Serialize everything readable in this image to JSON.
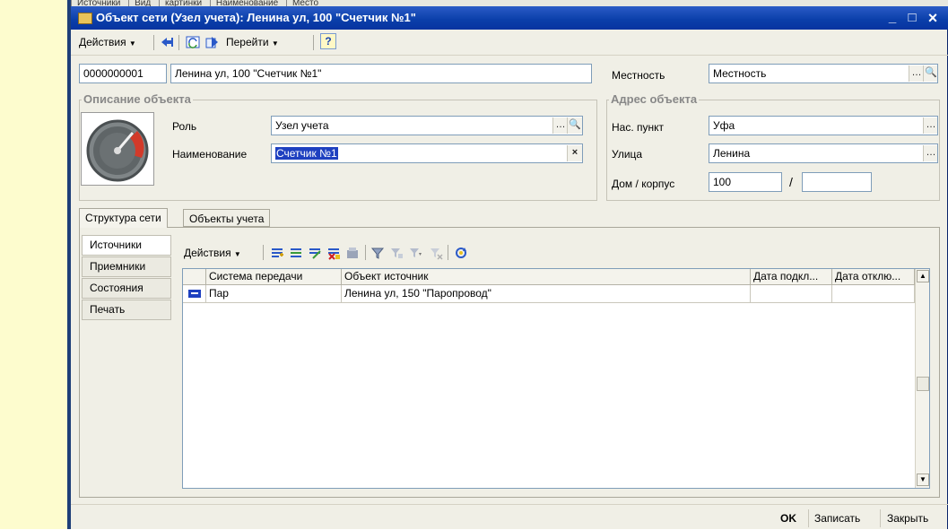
{
  "window": {
    "title": "Объект сети (Узел учета): Ленина ул, 100 \"Счетчик №1\"",
    "min": "_",
    "max": "□",
    "close": "×"
  },
  "top_remnant": {
    "items": [
      "Источники",
      "Вид",
      "картинки",
      "Наименование",
      "Место"
    ]
  },
  "toolbar": {
    "actions_label": "Действия",
    "goto_label": "Перейти",
    "help_label": "?"
  },
  "header": {
    "code": "0000000001",
    "name": "Ленина ул, 100 \"Счетчик №1\"",
    "locality_label": "Местность",
    "locality_value": "Местность"
  },
  "description": {
    "group_title": "Описание объекта",
    "role_label": "Роль",
    "role_value": "Узел учета",
    "name_label": "Наименование",
    "name_value": "Счетчик №1"
  },
  "address": {
    "group_title": "Адрес объекта",
    "city_label": "Нас. пункт",
    "city_value": "Уфа",
    "street_label": "Улица",
    "street_value": "Ленина",
    "house_label": "Дом / корпус",
    "house_value": "100",
    "slash": "/",
    "corpus_value": ""
  },
  "tabs": [
    "Структура сети",
    "Объекты учета"
  ],
  "side_tabs": [
    "Источники",
    "Приемники",
    "Состояния",
    "Печать"
  ],
  "grid_toolbar": {
    "actions_label": "Действия"
  },
  "grid": {
    "columns": [
      "Система передачи",
      "Объект источник",
      "Дата подкл...",
      "Дата отклю..."
    ],
    "rows": [
      {
        "system": "Пар",
        "source": "Ленина ул, 150 \"Паропровод\"",
        "date_on": "",
        "date_off": ""
      }
    ]
  },
  "footer": {
    "ok": "OK",
    "save": "Записать",
    "close": "Закрыть"
  },
  "colors": {
    "title_bar": "#0a3ea9",
    "window_bg": "#f0efe6",
    "selection": "#1e40c0",
    "yellow_bg": "#fdfcce"
  }
}
